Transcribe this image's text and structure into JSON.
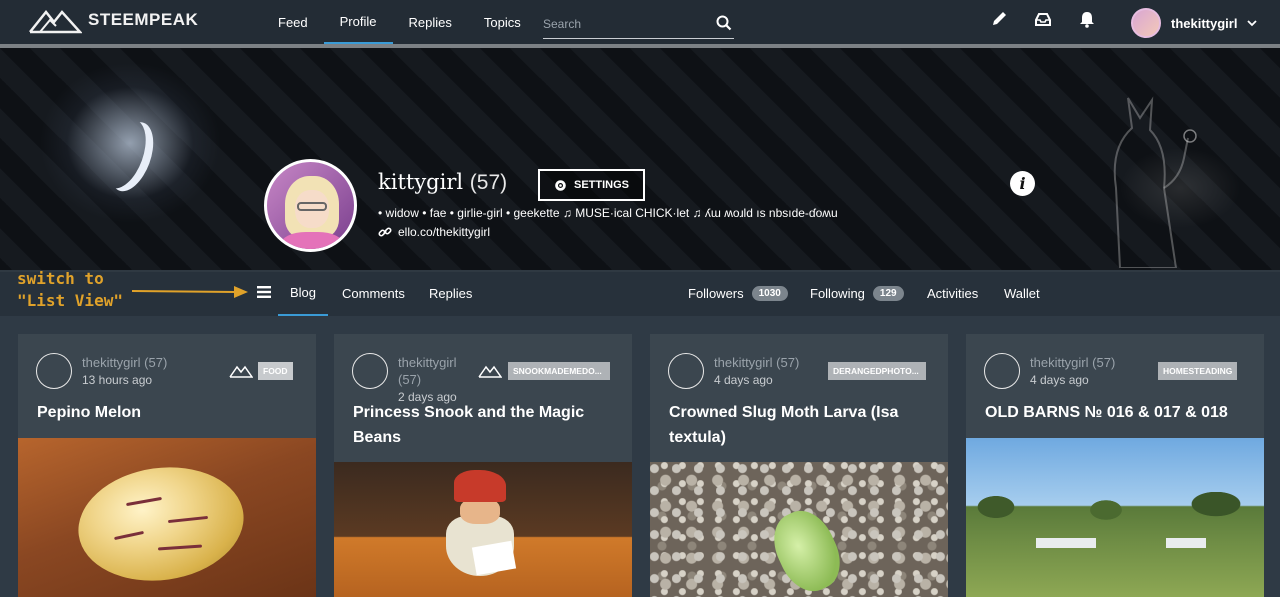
{
  "brand": {
    "name": "STEEMPEAK"
  },
  "nav": {
    "links": [
      "Feed",
      "Profile",
      "Replies",
      "Topics"
    ],
    "active": "Profile",
    "search_placeholder": "Search"
  },
  "user_menu": {
    "username": "thekittygirl"
  },
  "profile": {
    "display_name": "kittygirl",
    "reputation": "(57)",
    "settings_label": "SETTINGS",
    "bio": "• widow • fae • girlie-girl • geekette ♫ MUSE·ical CHICK·let ♫ ʎɯ ʍoɹld ıs nbsıde-ɗoʍu",
    "website": "ello.co/thekittygirl",
    "info_icon": "i"
  },
  "annotation": {
    "line1": "switch to",
    "line2": "\"List View\""
  },
  "tabs": {
    "left": [
      "Blog",
      "Comments",
      "Replies"
    ],
    "active": "Blog",
    "followers_label": "Followers",
    "followers_count": "1030",
    "following_label": "Following",
    "following_count": "129",
    "activities_label": "Activities",
    "wallet_label": "Wallet"
  },
  "posts": [
    {
      "author": "thekittygirl",
      "rep": "(57)",
      "time": "13 hours ago",
      "tag": "FOOD",
      "title": "Pepino Melon"
    },
    {
      "author": "thekittygirl",
      "rep": "(57)",
      "time": "2 days ago",
      "tag": "SNOOKMADEMEDO...",
      "title": "Princess Snook and the Magic Beans"
    },
    {
      "author": "thekittygirl",
      "rep": "(57)",
      "time": "4 days ago",
      "tag": "DERANGEDPHOTO...",
      "title": "Crowned Slug Moth Larva (Isa textula)"
    },
    {
      "author": "thekittygirl",
      "rep": "(57)",
      "time": "4 days ago",
      "tag": "HOMESTEADING",
      "title": "OLD BARNS № 016 & 017 & 018"
    }
  ],
  "colors": {
    "accent": "#3a9bd6",
    "nav_bg": "#232c35",
    "page_bg": "#2f3a45",
    "card_bg": "#3b464f",
    "annotation": "#e0a22a"
  },
  "icons": [
    "mountain-logo-icon",
    "search-icon",
    "pencil-icon",
    "inbox-icon",
    "bell-icon",
    "chevron-down-icon",
    "gear-icon",
    "link-icon",
    "info-icon",
    "list-view-icon",
    "arrow-right-icon"
  ]
}
